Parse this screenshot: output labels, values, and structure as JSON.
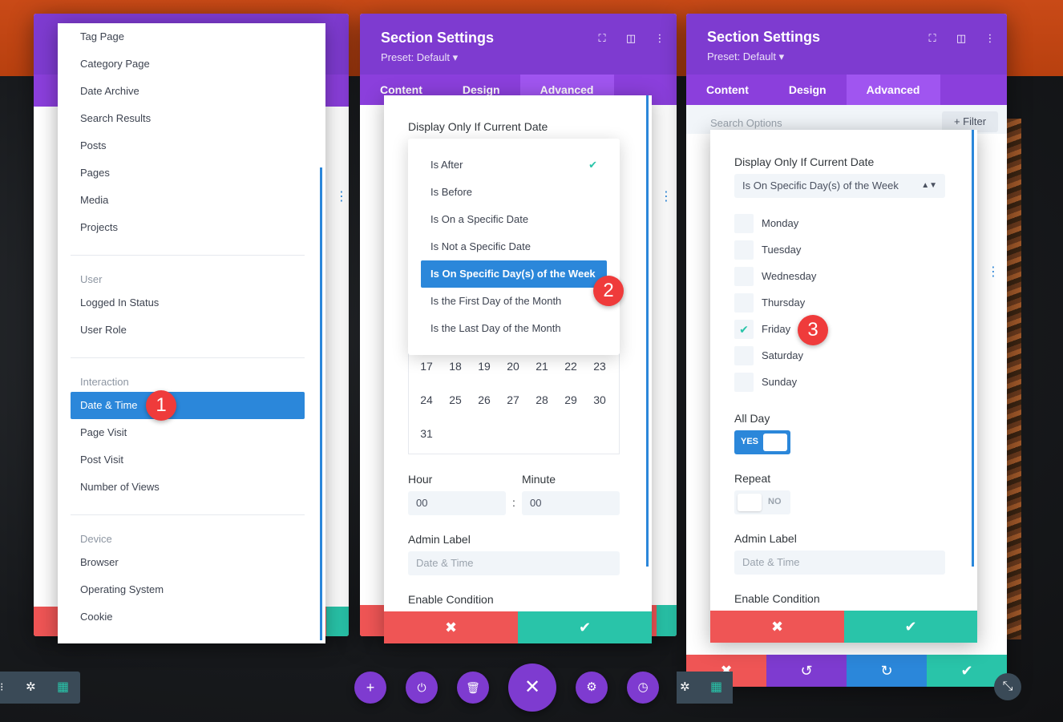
{
  "panel1": {
    "menu_items_top": [
      "Tag Page",
      "Category Page",
      "Date Archive",
      "Search Results",
      "Posts",
      "Pages",
      "Media",
      "Projects"
    ],
    "group_user": "User",
    "user_items": [
      "Logged In Status",
      "User Role"
    ],
    "group_interaction": "Interaction",
    "interaction_items": [
      "Date & Time",
      "Page Visit",
      "Post Visit",
      "Number of Views"
    ],
    "group_device": "Device",
    "device_items": [
      "Browser",
      "Operating System",
      "Cookie"
    ],
    "badge": "1"
  },
  "panel2": {
    "title": "Section Settings",
    "preset": "Preset: Default",
    "tabs": [
      "Content",
      "Design",
      "Advanced"
    ],
    "field_label": "Display Only If Current Date",
    "options": [
      "Is After",
      "Is Before",
      "Is On a Specific Date",
      "Is Not a Specific Date",
      "Is On Specific Day(s) of the Week",
      "Is the First Day of the Month",
      "Is the Last Day of the Month"
    ],
    "badge": "2",
    "calendar_rows": [
      [
        "17",
        "18",
        "19",
        "20",
        "21",
        "22",
        "23"
      ],
      [
        "24",
        "25",
        "26",
        "27",
        "28",
        "29",
        "30"
      ],
      [
        "31"
      ]
    ],
    "hour_label": "Hour",
    "minute_label": "Minute",
    "hour_value": "00",
    "minute_value": "00",
    "separator": ":",
    "admin_label": "Admin Label",
    "admin_placeholder": "Date & Time",
    "enable_condition": "Enable Condition"
  },
  "panel3": {
    "title": "Section Settings",
    "preset": "Preset: Default",
    "tabs": [
      "Content",
      "Design",
      "Advanced"
    ],
    "search_placeholder": "Search Options",
    "filter_label": "Filter",
    "field_label": "Display Only If Current Date",
    "select_value": "Is On Specific Day(s) of the Week",
    "days": [
      "Monday",
      "Tuesday",
      "Wednesday",
      "Thursday",
      "Friday",
      "Saturday",
      "Sunday"
    ],
    "checked_day": "Friday",
    "badge": "3",
    "all_day_label": "All Day",
    "all_day_toggle": "YES",
    "repeat_label": "Repeat",
    "repeat_toggle": "NO",
    "admin_label": "Admin Label",
    "admin_placeholder": "Date & Time",
    "enable_condition": "Enable Condition"
  },
  "colors": {
    "purple": "#7e3bd0",
    "blue": "#2b87da",
    "green": "#29c4a9",
    "red": "#ef5555",
    "badge_red": "#ef3b3b"
  },
  "icons": {
    "close": "close-icon",
    "check": "check-icon",
    "undo": "undo-icon",
    "redo": "redo-icon"
  }
}
